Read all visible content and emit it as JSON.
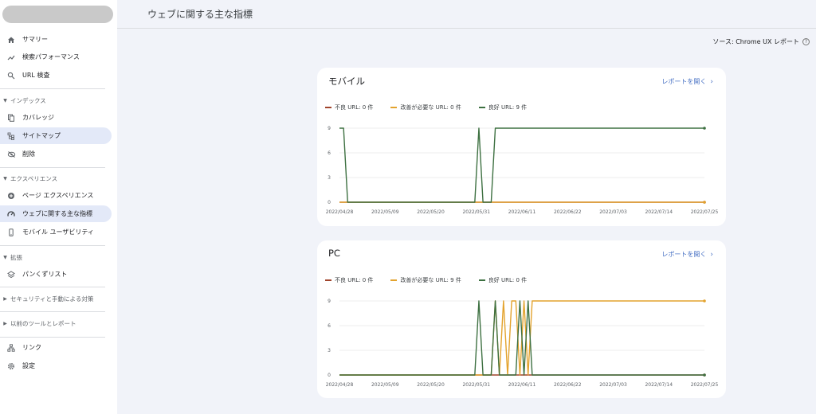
{
  "sidebar": {
    "items": [
      {
        "label": "サマリー",
        "icon": "home-icon",
        "active": false
      },
      {
        "label": "検索パフォーマンス",
        "icon": "trending-up-icon",
        "active": false
      },
      {
        "label": "URL 検査",
        "icon": "search-icon",
        "active": false
      }
    ],
    "sections": [
      {
        "label": "インデックス",
        "expanded": true,
        "items": [
          {
            "label": "カバレッジ",
            "icon": "file-copy-icon",
            "active": false
          },
          {
            "label": "サイトマップ",
            "icon": "sitemap-icon",
            "active": true
          },
          {
            "label": "削除",
            "icon": "visibility-off-icon",
            "active": false
          }
        ]
      },
      {
        "label": "エクスペリエンス",
        "expanded": true,
        "items": [
          {
            "label": "ページ エクスペリエンス",
            "icon": "plus-circle-icon",
            "active": false
          },
          {
            "label": "ウェブに関する主な指標",
            "icon": "speed-icon",
            "active": true
          },
          {
            "label": "モバイル ユーザビリティ",
            "icon": "smartphone-icon",
            "active": false
          }
        ]
      },
      {
        "label": "拡張",
        "expanded": true,
        "items": [
          {
            "label": "パンくずリスト",
            "icon": "layers-icon",
            "active": false
          }
        ]
      },
      {
        "label": "セキュリティと手動による対策",
        "expanded": false,
        "items": []
      },
      {
        "label": "以前のツールとレポート",
        "expanded": false,
        "items": []
      }
    ],
    "bottom_items": [
      {
        "label": "リンク",
        "icon": "links-icon"
      },
      {
        "label": "設定",
        "icon": "gear-icon"
      }
    ]
  },
  "header": {
    "title": "ウェブに関する主な指標",
    "source": "ソース: Chrome UX レポート"
  },
  "colors": {
    "poor": "#a0442c",
    "needs_improvement": "#e3a32e",
    "good": "#3d7041",
    "link": "#4a73c5"
  },
  "cards": [
    {
      "title": "モバイル",
      "link_label": "レポートを開く",
      "legend": [
        {
          "label": "不良 URL: 0 件",
          "key": "poor"
        },
        {
          "label": "改善が必要な URL: 0 件",
          "key": "needs_improvement"
        },
        {
          "label": "良好 URL: 9 件",
          "key": "good"
        }
      ]
    },
    {
      "title": "PC",
      "link_label": "レポートを開く",
      "legend": [
        {
          "label": "不良 URL: 0 件",
          "key": "poor"
        },
        {
          "label": "改善が必要な URL: 9 件",
          "key": "needs_improvement"
        },
        {
          "label": "良好 URL: 0 件",
          "key": "good"
        }
      ]
    }
  ],
  "chart_data": [
    {
      "type": "line",
      "title": "モバイル",
      "ylim": [
        0,
        9
      ],
      "yticks": [
        0,
        3,
        6,
        9
      ],
      "xlim": [
        "2022-04-27",
        "2022-07-25"
      ],
      "xtick_labels": [
        "2022/04/28",
        "2022/05/09",
        "2022/05/20",
        "2022/05/31",
        "2022/06/11",
        "2022/06/22",
        "2022/07/03",
        "2022/07/14",
        "2022/07/25"
      ],
      "grid": true,
      "series": [
        {
          "name": "不良 URL",
          "key": "poor",
          "x": [
            "2022-04-27",
            "2022-07-25"
          ],
          "y": [
            0,
            0
          ]
        },
        {
          "name": "改善が必要な URL",
          "key": "needs_improvement",
          "x": [
            "2022-04-27",
            "2022-07-25"
          ],
          "y": [
            0,
            0
          ]
        },
        {
          "name": "良好 URL",
          "key": "good",
          "x": [
            "2022-04-27",
            "2022-04-28",
            "2022-04-29",
            "2022-05-30",
            "2022-05-31",
            "2022-06-01",
            "2022-06-03",
            "2022-06-04",
            "2022-07-25"
          ],
          "y": [
            9,
            9,
            0,
            0,
            9,
            0,
            0,
            9,
            9
          ]
        }
      ]
    },
    {
      "type": "line",
      "title": "PC",
      "ylim": [
        0,
        9
      ],
      "yticks": [
        0,
        3,
        6,
        9
      ],
      "xlim": [
        "2022-04-27",
        "2022-07-25"
      ],
      "xtick_labels": [
        "2022/04/28",
        "2022/05/09",
        "2022/05/20",
        "2022/05/31",
        "2022/06/11",
        "2022/06/22",
        "2022/07/03",
        "2022/07/14",
        "2022/07/25"
      ],
      "grid": true,
      "series": [
        {
          "name": "不良 URL",
          "key": "poor",
          "x": [
            "2022-04-27",
            "2022-07-25"
          ],
          "y": [
            0,
            0
          ]
        },
        {
          "name": "改善が必要な URL",
          "key": "needs_improvement",
          "x": [
            "2022-04-27",
            "2022-06-03",
            "2022-06-04",
            "2022-06-05",
            "2022-06-06",
            "2022-06-07",
            "2022-06-08",
            "2022-06-09",
            "2022-06-10",
            "2022-06-11",
            "2022-06-12",
            "2022-06-13",
            "2022-06-14",
            "2022-07-25"
          ],
          "y": [
            0,
            0,
            9,
            0,
            9,
            0,
            9,
            9,
            0,
            9,
            0,
            9,
            9,
            9
          ]
        },
        {
          "name": "良好 URL",
          "key": "good",
          "x": [
            "2022-04-27",
            "2022-05-30",
            "2022-05-31",
            "2022-06-01",
            "2022-06-03",
            "2022-06-04",
            "2022-06-05",
            "2022-06-09",
            "2022-06-10",
            "2022-06-11",
            "2022-06-12",
            "2022-06-13",
            "2022-06-14",
            "2022-07-25"
          ],
          "y": [
            0,
            0,
            9,
            0,
            0,
            9,
            0,
            0,
            9,
            0,
            9,
            0,
            0,
            0
          ]
        }
      ]
    }
  ]
}
